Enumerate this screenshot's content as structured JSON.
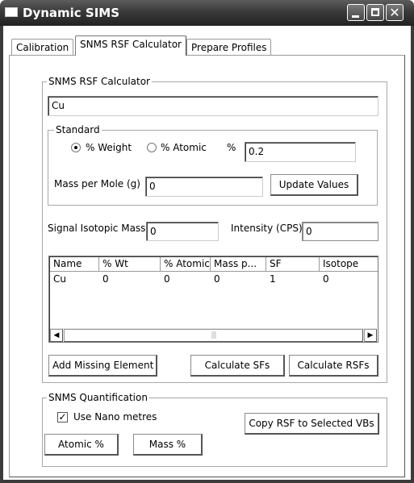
{
  "window": {
    "title": "Dynamic SIMS",
    "controls": {
      "minimize_icon": "minimize-icon",
      "maximize_icon": "maximize-icon",
      "close_label": "✕"
    }
  },
  "tabs": [
    {
      "label": "Calibration",
      "active": false
    },
    {
      "label": "SNMS RSF Calculator",
      "active": true
    },
    {
      "label": "Prepare Profiles",
      "active": false
    }
  ],
  "rsf_calculator": {
    "group_label": "SNMS RSF Calculator",
    "element_value": "Cu",
    "standard": {
      "group_label": "Standard",
      "weight_label": "% Weight",
      "atomic_label": "% Atomic",
      "selected": "weight",
      "percent_label": "%",
      "percent_value": "0.2",
      "mass_per_mole_label": "Mass per Mole (g)",
      "mass_per_mole_value": "0",
      "update_button": "Update Values"
    },
    "signal_isotopic_mass_label": "Signal Isotopic Mass",
    "signal_isotopic_mass_value": "0",
    "intensity_label": "Intensity (CPS)",
    "intensity_value": "0",
    "table": {
      "columns": [
        "Name",
        "% Wt",
        "% Atomic",
        "Mass p...",
        "SF",
        "Isotope"
      ],
      "rows": [
        [
          "Cu",
          "0",
          "0",
          "0",
          "1",
          "0"
        ]
      ]
    },
    "scroll": {
      "left_arrow": "◀",
      "right_arrow": "▶",
      "grip": "|||"
    },
    "add_missing_button": "Add Missing Element",
    "calculate_sfs_button": "Calculate SFs",
    "calculate_rsfs_button": "Calculate RSFs"
  },
  "quantification": {
    "group_label": "SNMS Quantification",
    "use_nano_label": "Use Nano metres",
    "use_nano_checked": true,
    "check_mark": "✓",
    "copy_rsf_button": "Copy RSF to Selected VBs",
    "atomic_button": "Atomic %",
    "mass_button": "Mass %"
  }
}
